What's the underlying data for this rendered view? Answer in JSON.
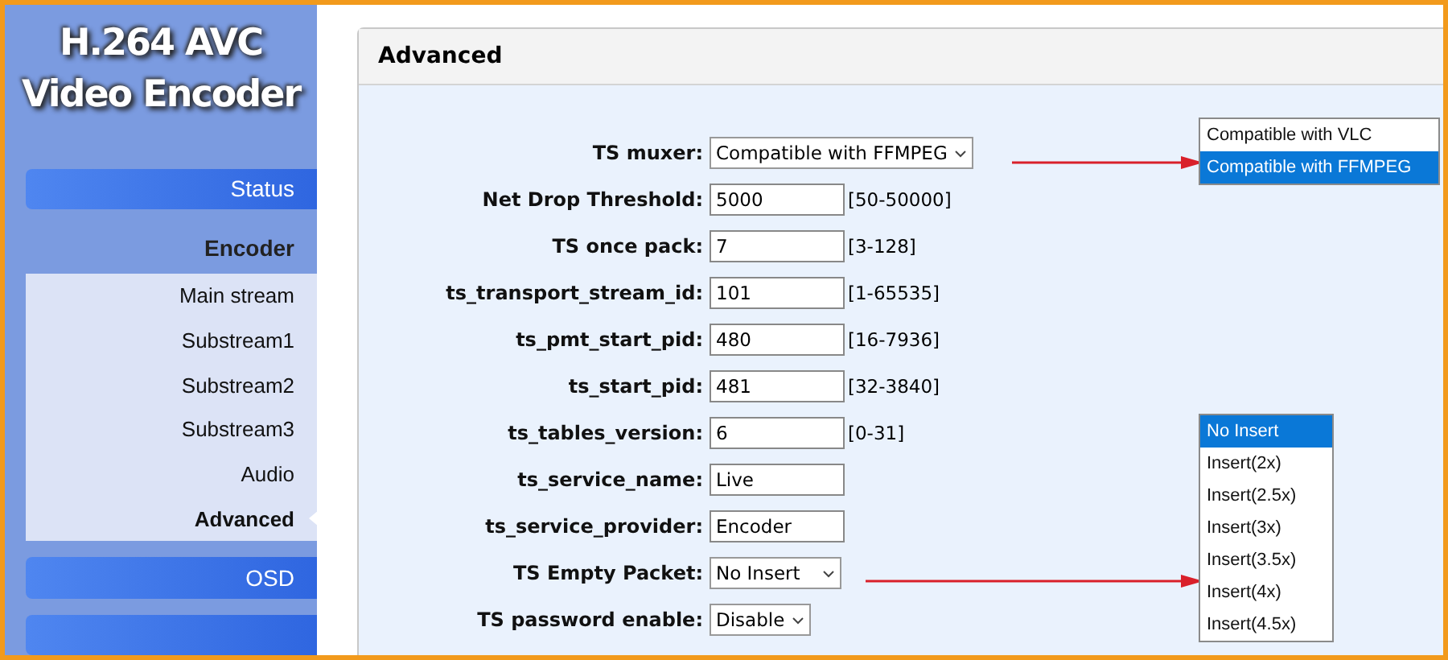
{
  "sidebar": {
    "title": [
      "H.264 AVC",
      "Video Encoder"
    ],
    "items": [
      {
        "kind": "button",
        "label": "Status",
        "selected": false
      },
      {
        "kind": "header",
        "label": "Encoder",
        "selected": false
      },
      {
        "kind": "subitem",
        "label": "Main stream",
        "selected": false
      },
      {
        "kind": "subitem",
        "label": "Substream1",
        "selected": false
      },
      {
        "kind": "subitem",
        "label": "Substream2",
        "selected": false
      },
      {
        "kind": "subitem",
        "label": "Substream3",
        "selected": false
      },
      {
        "kind": "subitem",
        "label": "Audio",
        "selected": false
      },
      {
        "kind": "subitem",
        "label": "Advanced",
        "selected": true
      },
      {
        "kind": "button",
        "label": "OSD",
        "selected": false
      },
      {
        "kind": "button",
        "selected": false
      }
    ]
  },
  "panel": {
    "title": "Advanced",
    "rows": [
      {
        "kind": "select",
        "label": "TS muxer:",
        "value": "Compatible with FFMPEG"
      },
      {
        "kind": "input",
        "label": "Net Drop Threshold:",
        "value": "5000",
        "range": "[50-50000]"
      },
      {
        "kind": "input",
        "label": "TS once pack:",
        "value": "7",
        "range": "[3-128]"
      },
      {
        "kind": "input",
        "label": "ts_transport_stream_id:",
        "value": "101",
        "range": "[1-65535]"
      },
      {
        "kind": "input",
        "label": "ts_pmt_start_pid:",
        "value": "480",
        "range": "[16-7936]"
      },
      {
        "kind": "input",
        "label": "ts_start_pid:",
        "value": "481",
        "range": "[32-3840]"
      },
      {
        "kind": "input",
        "label": "ts_tables_version:",
        "value": "6",
        "range": "[0-31]"
      },
      {
        "kind": "input",
        "label": "ts_service_name:",
        "value": "Live"
      },
      {
        "kind": "input",
        "label": "ts_service_provider:",
        "value": "Encoder"
      },
      {
        "kind": "select",
        "label": "TS Empty Packet:",
        "value": "No Insert"
      },
      {
        "kind": "select",
        "label": "TS password enable:",
        "value": "Disable"
      }
    ]
  },
  "dropdowns": [
    {
      "options": [
        {
          "label": "Compatible with VLC",
          "selected": false
        },
        {
          "label": "Compatible with FFMPEG",
          "selected": true
        }
      ]
    },
    {
      "options": [
        {
          "label": "No Insert",
          "selected": true
        },
        {
          "label": "Insert(2x)",
          "selected": false
        },
        {
          "label": "Insert(2.5x)",
          "selected": false
        },
        {
          "label": "Insert(3x)",
          "selected": false
        },
        {
          "label": "Insert(3.5x)",
          "selected": false
        },
        {
          "label": "Insert(4x)",
          "selected": false
        },
        {
          "label": "Insert(4.5x)",
          "selected": false
        }
      ]
    }
  ]
}
